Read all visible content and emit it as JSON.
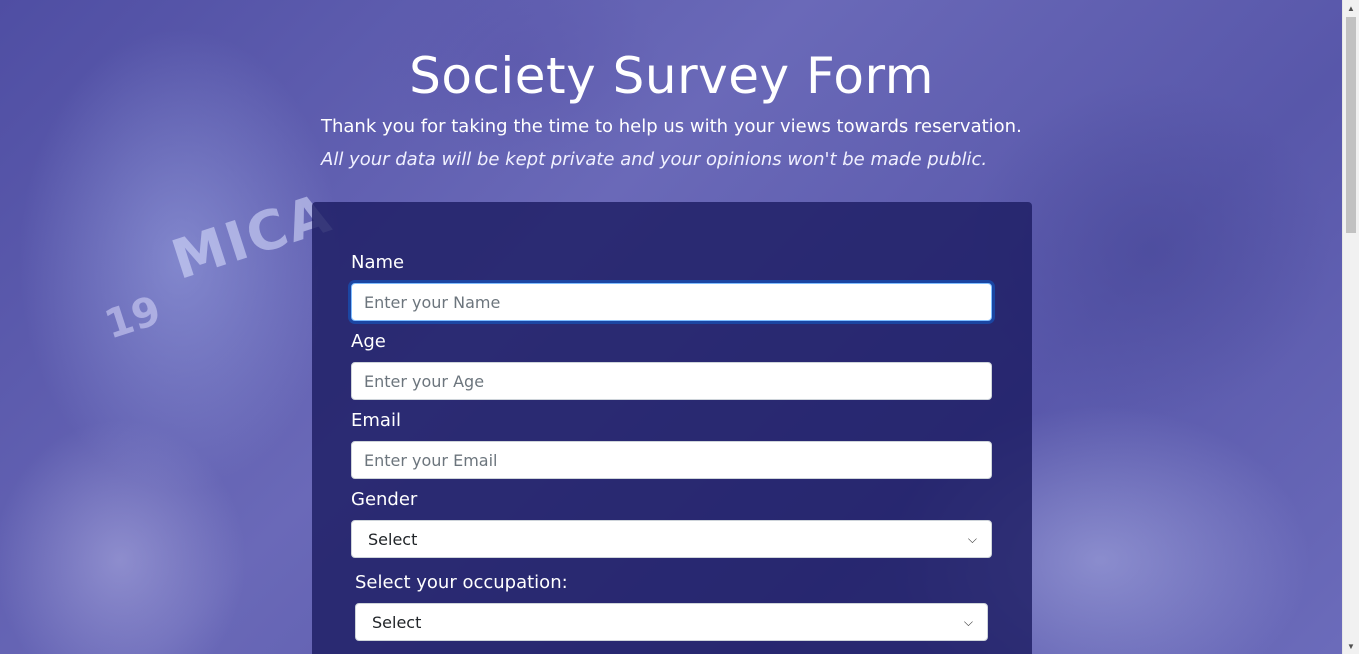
{
  "header": {
    "title": "Society Survey Form",
    "description": "Thank you for taking the time to help us with your views towards reservation.",
    "note": "All your data will be kept private and your opinions won't be made public."
  },
  "form": {
    "name": {
      "label": "Name",
      "placeholder": "Enter your Name",
      "value": ""
    },
    "age": {
      "label": "Age",
      "placeholder": "Enter your Age",
      "value": ""
    },
    "email": {
      "label": "Email",
      "placeholder": "Enter your Email",
      "value": ""
    },
    "gender": {
      "label": "Gender",
      "selected": "Select"
    },
    "occupation": {
      "label": "Select your occupation:",
      "selected": "Select"
    }
  },
  "background": {
    "jersey_text": "MICA",
    "jersey_number": "19"
  },
  "colors": {
    "card": "#1b1c62",
    "background": "#5b5aa8",
    "focus": "#80bdff"
  },
  "icons": {
    "select_chevron": "chevron-down-icon",
    "scroll_up": "scroll-up-arrow-icon",
    "scroll_down": "scroll-down-arrow-icon"
  }
}
